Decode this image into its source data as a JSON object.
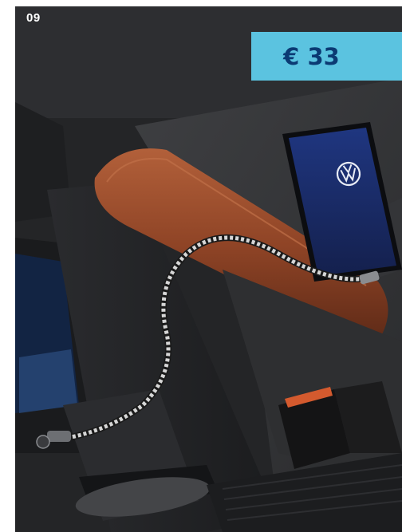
{
  "page": {
    "number": "09"
  },
  "price_tag": {
    "label": "€ 33"
  },
  "photo": {
    "colors": {
      "background": "#202123",
      "seat_fabric": "#3a3b3d",
      "leather_armrest": "#9a4a2a",
      "phone_screen": "#1a2d6b",
      "cable": "#cfcfcf",
      "price_tag": "#5bc3e0",
      "price_text": "#0b3a73"
    },
    "icons": [
      "vw-logo-icon",
      "usb-c-icon",
      "seatbelt-buckle-icon"
    ]
  }
}
